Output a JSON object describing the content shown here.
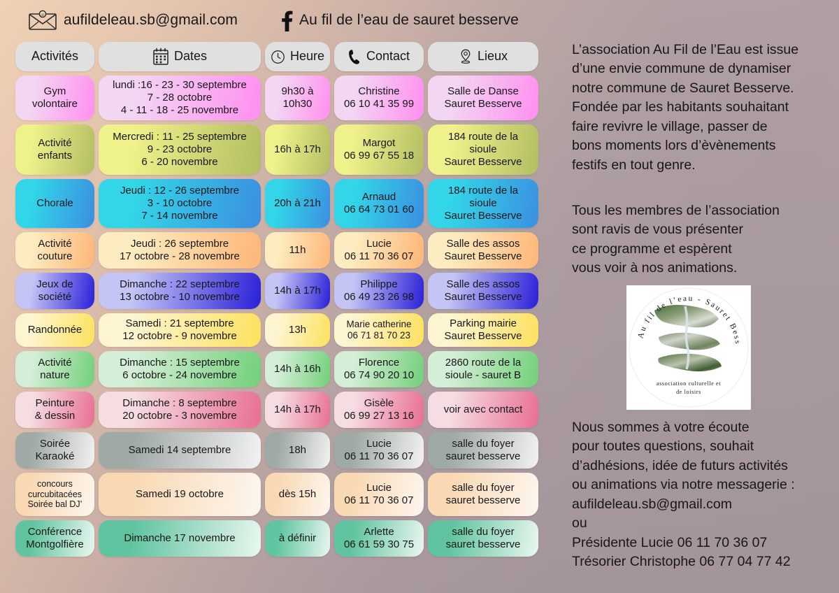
{
  "topbar": {
    "email": "aufildeleau.sb@gmail.com",
    "facebook": "Au fil de l’eau de sauret besserve",
    "mail_icon": "envelope-icon",
    "facebook_icon": "facebook-icon"
  },
  "table": {
    "headers": [
      {
        "label": "Activités",
        "icon": ""
      },
      {
        "label": "Dates",
        "icon": "calendar-icon"
      },
      {
        "label": "Heure",
        "icon": "clock-icon"
      },
      {
        "label": "Contact",
        "icon": "phone-icon"
      },
      {
        "label": "Lieux",
        "icon": "map-pin-icon"
      }
    ],
    "rows": [
      {
        "activity": "Gym\nvolontaire",
        "dates": "lundi :16 - 23 - 30 septembre\n7 - 28 octobre\n4 - 11 - 18 - 25 novembre",
        "time": "9h30 à\n10h30",
        "contact": "Christine\n06 10 41 35 99",
        "place": "Salle de Danse\nSauret Besserve",
        "color_light": "#f3d7f2",
        "color_strong": "#ff8ff0"
      },
      {
        "activity": "Activité\nenfants",
        "dates": "Mercredi : 11 - 25 septembre\n9 - 23 octobre\n6 - 20 novembre",
        "time": "16h à 17h",
        "contact": "Margot\n06 99 67 55 18",
        "place": "184 route de la\nsioule\nSauret Besserve",
        "color_light": "#eff18a",
        "color_strong": "#b3bd63"
      },
      {
        "activity": "Chorale",
        "dates": "Jeudi : 12 - 26 septembre\n3 - 10 octobre\n7 - 14 novembre",
        "time": "20h à 21h",
        "contact": "Arnaud\n06 64 73 01 60",
        "place": "184 route de la\nsioule\nSauret Besserve",
        "color_light": "#32d6e8",
        "color_strong": "#3b8fe0"
      },
      {
        "activity": "Activité\ncouture",
        "dates": "Jeudi : 26 septembre\n17 octobre - 28 novembre",
        "time": "11h",
        "contact": "Lucie\n06 11 70 36 07",
        "place": "Salle des assos\nSauret Besserve",
        "color_light": "#fdecc0",
        "color_strong": "#fdb678"
      },
      {
        "activity": "Jeux de\nsociété",
        "dates": "Dimanche : 22 septembre\n13 octobre - 10 novembre",
        "time": "14h à 17h",
        "contact": "Philippe\n06 49 23 26 98",
        "place": "Salle des assos\nSauret Besserve",
        "color_light": "#c4c4f5",
        "color_strong": "#2a20d8"
      },
      {
        "activity": "Randonnée",
        "dates": "Samedi : 21 septembre\n12 octobre - 9 novembre",
        "time": "13h",
        "contact": "Marie catherine\n06 71 81 70 23",
        "place": "Parking mairie\nSauret Besserve",
        "color_light": "#fdf5cf",
        "color_strong": "#fde15e"
      },
      {
        "activity": "Activité\nnature",
        "dates": "Dimanche : 15 septembre\n6 octobre - 24 novembre",
        "time": "14h à 16h",
        "contact": "Florence\n06 74 90 20 10",
        "place": "2860 route de la\nsioule - sauret B",
        "color_light": "#d5eed7",
        "color_strong": "#72d07a"
      },
      {
        "activity": "Peinture\n& dessin",
        "dates": "Dimanche : 8 septembre\n20 octobre - 3 novembre",
        "time": "14h à 17h",
        "contact": "Gisèle\n06 99 27 13 16",
        "place": "voir avec contact",
        "color_light": "#f6dde2",
        "color_strong": "#e86f92"
      },
      {
        "activity": "Soirée\nKaraoké",
        "dates": "Samedi 14 septembre",
        "time": "18h",
        "contact": "Lucie\n06 11 70 36 07",
        "place": "salle du foyer\nsauret besserve",
        "color_light": "#9fa9a6",
        "color_strong": "#f2f2f2"
      },
      {
        "activity": "concours\ncurcubitacées\nSoirée bal DJ’",
        "dates": "Samedi 19 octobre",
        "time": "dès 15h",
        "contact": "Lucie\n06 11 70 36 07",
        "place": "salle du foyer\nsauret besserve",
        "color_light": "#f9d9b4",
        "color_strong": "#fdf6ee"
      },
      {
        "activity": "Conférence\nMontgolfière",
        "dates": "Dimanche 17 novembre",
        "time": "à définir",
        "contact": "Arlette\n06 61 59 30 75",
        "place": "salle du foyer\nsauret besserve",
        "color_light": "#61c4a0",
        "color_strong": "#eaf7ef"
      }
    ]
  },
  "side": {
    "intro": "L’association Au Fil de l’Eau est issue\nd’une envie commune de dynamiser\nnotre commune de Sauret Besserve.\nFondée par les habitants souhaitant\nfaire revivre le village, passer de\nbons moments lors d’èvènements\nfestifs en tout genre.",
    "members": "Tous les membres de l’association\nsont ravis de vous présenter\nce programme et espèrent\nvous voir à nos animations.",
    "contact": "Nous sommes à votre écoute\npour toutes questions, souhait\nd’adhésions, idée de futurs activités\nou animations via notre messagerie :\naufildeleau.sb@gmail.com\nou\nPrésidente Lucie 06 11 70 36 07\nTrésorier Christophe 06 77 04 77 42"
  },
  "logo": {
    "circle_text": "Au fil de l’eau - Sauret Besserve",
    "subtitle_line1": "association culturelle et",
    "subtitle_line2": "de loisirs"
  }
}
